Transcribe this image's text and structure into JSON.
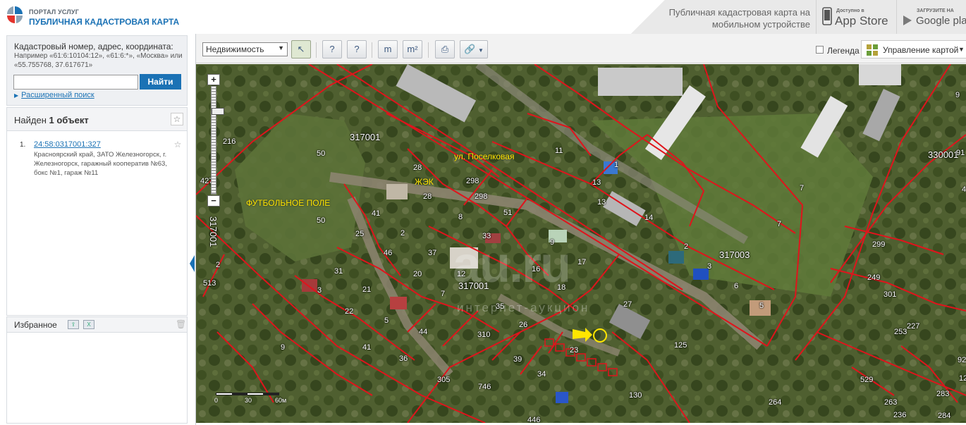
{
  "header": {
    "portal_label": "ПОРТАЛ УСЛУГ",
    "title": "ПУБЛИЧНАЯ КАДАСТРОВАЯ КАРТА",
    "promo_text": "Публичная кадастровая карта на мобильном устройстве",
    "appstore_small": "Доступно в",
    "appstore_big": "App Store",
    "gplay_small": "ЗАГРУЗИТЕ НА",
    "gplay_big": "Google play"
  },
  "search": {
    "hint_title": "Кадастровый номер, адрес, координата:",
    "hint_examples": "Например «61:6:10104:12», «61:6:*», «Москва» или «55.755768, 37.617671»",
    "input_value": "",
    "button_label": "Найти",
    "advanced_label": "Расширенный поиск"
  },
  "results": {
    "found_prefix": "Найден",
    "found_count": "1 объект",
    "items": [
      {
        "num": "1.",
        "number": "24:58:0317001:327",
        "address": "Красноярский край, ЗАТО Железногорск, г. Железногорск, гаражный кооператив №63, бокс №1, гараж №11"
      }
    ]
  },
  "favorites": {
    "title": "Избранное"
  },
  "toolbar": {
    "select_value": "Недвижимость",
    "legend_label": "Легенда",
    "legend_checked": false,
    "map_control_label": "Управление картой"
  },
  "map": {
    "labels": [
      {
        "text": "317001",
        "style": "big"
      },
      {
        "text": "50",
        "style": ""
      },
      {
        "text": "ул. Поселковая",
        "style": "yel"
      },
      {
        "text": "ЖЭК",
        "style": "yel"
      },
      {
        "text": "ФУТБОЛЬНОЕ ПОЛЕ",
        "style": "yel"
      },
      {
        "text": "317001",
        "style": "big"
      },
      {
        "text": "317003",
        "style": "big"
      },
      {
        "text": "330001",
        "style": "big"
      },
      {
        "text": "317001",
        "style": "big"
      }
    ],
    "parcel_numbers": [
      "216",
      "50",
      "28",
      "298",
      "298",
      "28",
      "11",
      "1",
      "13",
      "13",
      "14",
      "8",
      "51",
      "41",
      "25",
      "2",
      "46",
      "37",
      "33",
      "9",
      "17",
      "16",
      "31",
      "3",
      "21",
      "20",
      "12",
      "7",
      "18",
      "27",
      "22",
      "5",
      "35",
      "26",
      "44",
      "310",
      "23",
      "41",
      "36",
      "39",
      "34",
      "305",
      "746",
      "130",
      "446",
      "125",
      "2",
      "3",
      "6",
      "5",
      "7",
      "7",
      "9",
      "299",
      "249",
      "301",
      "253",
      "227",
      "529",
      "264",
      "263",
      "283",
      "236",
      "284",
      "42",
      "513",
      "2",
      "91",
      "92",
      "9",
      "427",
      "12"
    ],
    "scale": {
      "zero": "0",
      "mid": "30",
      "end": "60м"
    },
    "watermark": "au.ru",
    "watermark_sub": "интернет-аукцион"
  }
}
